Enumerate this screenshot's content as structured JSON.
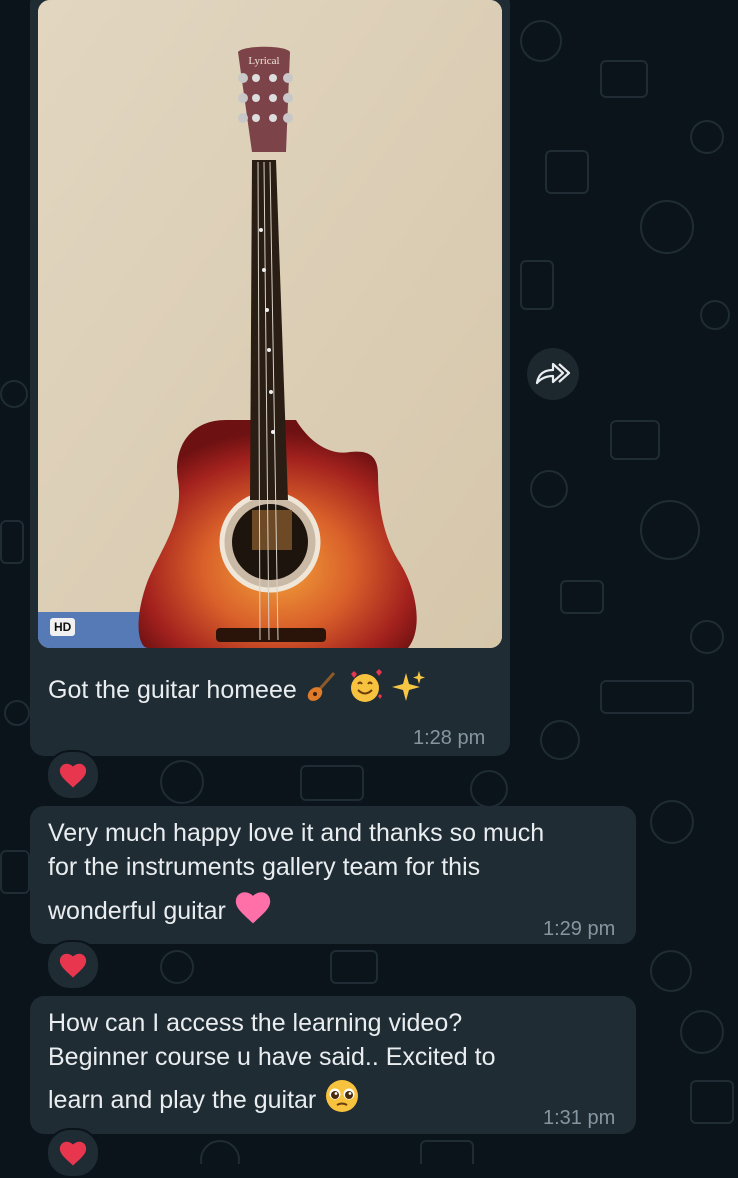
{
  "messages": [
    {
      "text": "Got the guitar homeee",
      "time": "1:28 pm",
      "badge": "HD",
      "image_brand": "Lyrical",
      "reaction": "heart-icon"
    },
    {
      "text": "Very much happy love it and thanks so much for the instruments gallery team for this wonderful guitar",
      "lines": [
        "Very much happy love it and thanks so much",
        "for the instruments gallery team for this",
        "wonderful guitar"
      ],
      "time": "1:29 pm",
      "reaction": "heart-icon"
    },
    {
      "text": "How can I access the learning video? Beginner course u have said.. Excited to learn and play the guitar",
      "lines": [
        "How can I access the learning video?",
        "Beginner course u have said.. Excited to",
        "learn and play the guitar"
      ],
      "time": "1:31 pm",
      "reaction": "heart-icon"
    }
  ],
  "colors": {
    "background": "#0b141a",
    "bubble": "#1f2c34",
    "text": "#e9edef",
    "time": "#8696a0",
    "heart": "#e8364e"
  }
}
